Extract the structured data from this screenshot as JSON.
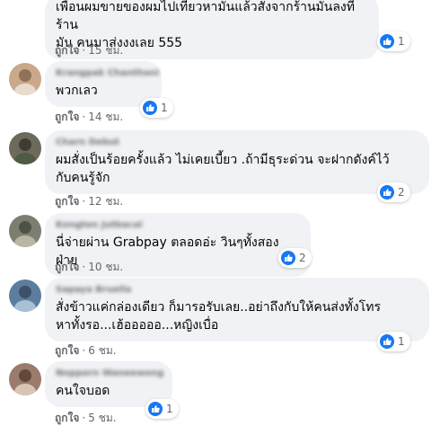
{
  "accent_color": "#1877f2",
  "comments": [
    {
      "text": "เพื่อนผมขายของผมไปเที่ยวหามันแล้วสั่งจากร้านมันลงที่ร้าน\nมัน คนมาส่งงงเลย 555",
      "like_label": "ถูกใจ",
      "time": "15 ชม.",
      "reactions": "1",
      "avatar_color": "#8a8f98",
      "reaction_icon": "thumbs-up-icon"
    },
    {
      "author": "Krangpak Chanthani",
      "text": "พวกเลว",
      "like_label": "ถูกใจ",
      "time": "14 ชม.",
      "reactions": "1",
      "avatar_color": "#c9a98a",
      "reaction_icon": "thumbs-up-icon"
    },
    {
      "author": "Charn Debut",
      "text": "ผมสั่งเป็นร้อยครั้งแล้ว ไม่เคยเบี้ยว .ถ้ามีธุระด่วน จะฝากดังค์ไว้\nกับคนรู้จัก",
      "like_label": "ถูกใจ",
      "time": "12 ชม.",
      "reactions": "2",
      "avatar_color": "#6d6a5c",
      "reaction_icon": "thumbs-up-icon"
    },
    {
      "author": "Kongten Jutbacal",
      "text": "นี่จ่ายผ่าน Grabpay ตลอดอ่ะ วินๆทั้งสองฝ่าย",
      "like_label": "ถูกใจ",
      "time": "10 ชม.",
      "reactions": "2",
      "avatar_color": "#7b7f72",
      "reaction_icon": "thumbs-up-icon"
    },
    {
      "author": "Sapaya Bruella",
      "text": "สั่งข้าวแค่กล่องเดียว ก็มารอรับเลย..อย่าถึงกับให้คนส่งทั้งโทร\nหาทั้งรอ...เฮ้อออออ...หญิงเบื่อ",
      "like_label": "ถูกใจ",
      "time": "6 ชม.",
      "reactions": "1",
      "avatar_color": "#5e7d9c",
      "reaction_icon": "thumbs-up-icon"
    },
    {
      "author": "Nopporn Waneewong",
      "text": "คนใจบอด",
      "like_label": "ถูกใจ",
      "time": "5 ชม.",
      "reactions": "1",
      "avatar_color": "#9a7b6c",
      "reaction_icon": "thumbs-up-icon"
    }
  ]
}
